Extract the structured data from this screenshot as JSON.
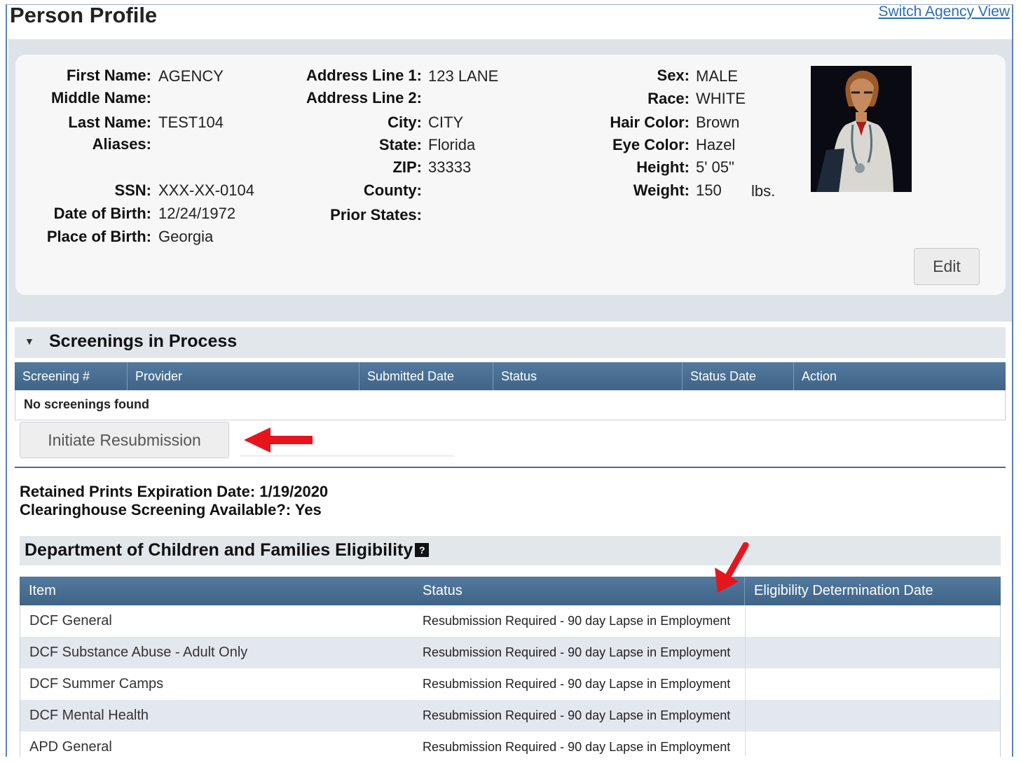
{
  "page": {
    "title": "Person Profile",
    "switch_link": "Switch Agency View"
  },
  "profile": {
    "col1": [
      {
        "label": "First Name:",
        "value": "AGENCY"
      },
      {
        "label": "Middle Name:",
        "value": ""
      },
      {
        "label": "Last Name:",
        "value": "TEST104"
      },
      {
        "label": "Aliases:",
        "value": ""
      },
      {
        "label": "SSN:",
        "value": "XXX-XX-0104"
      },
      {
        "label": "Date of Birth:",
        "value": "12/24/1972"
      },
      {
        "label": "Place of Birth:",
        "value": "Georgia"
      }
    ],
    "col2": [
      {
        "label": "Address Line 1:",
        "value": "123 LANE"
      },
      {
        "label": "Address Line 2:",
        "value": ""
      },
      {
        "label": "City:",
        "value": "CITY"
      },
      {
        "label": "State:",
        "value": "Florida"
      },
      {
        "label": "ZIP:",
        "value": "33333"
      },
      {
        "label": "County:",
        "value": ""
      },
      {
        "label": "Prior States:",
        "value": ""
      }
    ],
    "col3": [
      {
        "label": "Sex:",
        "value": "MALE"
      },
      {
        "label": "Race:",
        "value": "WHITE"
      },
      {
        "label": "Hair Color:",
        "value": "Brown"
      },
      {
        "label": "Eye Color:",
        "value": "Hazel"
      },
      {
        "label": "Height:",
        "value": "5' 05\""
      },
      {
        "label": "Weight:",
        "value": "150",
        "unit": "lbs."
      }
    ],
    "edit_label": "Edit"
  },
  "screenings": {
    "title": "Screenings in Process",
    "columns": [
      "Screening #",
      "Provider",
      "Submitted Date",
      "Status",
      "Status Date",
      "Action"
    ],
    "empty_text": "No screenings found",
    "resubmit_label": "Initiate Resubmission"
  },
  "retained": {
    "expiration": "Retained Prints Expiration Date: 1/19/2020",
    "clearinghouse": "Clearinghouse Screening Available?: Yes"
  },
  "eligibility": {
    "title": "Department of Children and Families Eligibility",
    "help_icon": "?",
    "columns": [
      "Item",
      "Status",
      "Eligibility Determination Date"
    ],
    "rows": [
      {
        "item": "DCF General",
        "status": "Resubmission Required - 90 day Lapse in Employment",
        "date": ""
      },
      {
        "item": "DCF Substance Abuse - Adult Only",
        "status": "Resubmission Required - 90 day Lapse in Employment",
        "date": ""
      },
      {
        "item": "DCF Summer Camps",
        "status": "Resubmission Required - 90 day Lapse in Employment",
        "date": ""
      },
      {
        "item": "DCF Mental Health",
        "status": "Resubmission Required - 90 day Lapse in Employment",
        "date": ""
      },
      {
        "item": "APD General",
        "status": "Resubmission Required - 90 day Lapse in Employment",
        "date": ""
      }
    ]
  },
  "colors": {
    "header_blue": "#3f6488",
    "band_gray": "#dde3e9",
    "annotation_red": "#e8141c"
  }
}
